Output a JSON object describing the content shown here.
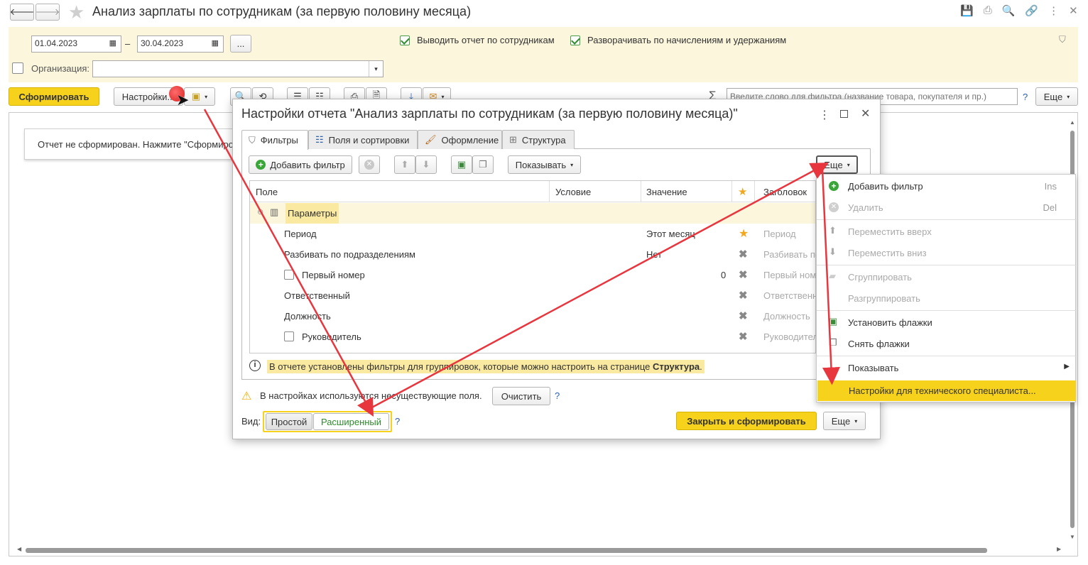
{
  "window": {
    "title": "Анализ зарплаты по сотрудникам (за первую половину месяца)"
  },
  "params": {
    "date_from": "01.04.2023",
    "date_to": "30.04.2023",
    "dash": "–",
    "ellipsis": "...",
    "show_by_employees_label": "Выводить отчет по сотрудникам",
    "expand_label": "Разворачивать по начислениям и удержаниям",
    "org_label": "Организация:",
    "org_value": ""
  },
  "toolbar": {
    "form_label": "Сформировать",
    "settings_label": "Настройки...",
    "sigma": "Σ",
    "search_placeholder": "Введите слово для фильтра (название товара, покупателя и пр.)",
    "help": "?",
    "more_label": "Еще"
  },
  "report": {
    "status": "Отчет не сформирован. Нажмите \"Сформировать\""
  },
  "dialog": {
    "title": "Настройки отчета \"Анализ зарплаты по сотрудникам (за первую половину месяца)\"",
    "tabs": [
      {
        "label": "Фильтры"
      },
      {
        "label": "Поля и сортировки"
      },
      {
        "label": "Оформление"
      },
      {
        "label": "Структура"
      }
    ],
    "add_filter_label": "Добавить фильтр",
    "show_label": "Показывать",
    "more_label": "Еще",
    "columns": {
      "field": "Поле",
      "condition": "Условие",
      "value": "Значение",
      "title": "Заголовок"
    },
    "group_label": "Параметры",
    "rows": [
      {
        "field": "Период",
        "value": "Этот месяц",
        "title": "Период"
      },
      {
        "field": "Разбивать по подразделениям",
        "value": "Нет",
        "title": "Разбивать по"
      },
      {
        "field": "Первый номер",
        "value": "0",
        "title": "Первый ном"
      },
      {
        "field": "Ответственный",
        "value": "",
        "title": "Ответственн"
      },
      {
        "field": "Должность",
        "value": "",
        "title": "Должность"
      },
      {
        "field": "Руководитель",
        "value": "",
        "title": "Руководител"
      }
    ],
    "info_text": "В отчете установлены фильтры для группировок, которые можно настроить на странице ",
    "info_bold": "Структура",
    "info_end": ".",
    "warning_text": "В настройках используются несуществующие поля.",
    "clear_label": "Очистить",
    "help": "?",
    "view_label": "Вид:",
    "view_simple": "Простой",
    "view_extended": "Расширенный",
    "close_form_label": "Закрыть и сформировать",
    "bottom_more_label": "Еще"
  },
  "menu": {
    "items": [
      {
        "label": "Добавить фильтр",
        "key": "Ins"
      },
      {
        "label": "Удалить",
        "key": "Del"
      },
      {
        "label": "Переместить вверх",
        "key": ""
      },
      {
        "label": "Переместить вниз",
        "key": ""
      },
      {
        "label": "Сгруппировать",
        "key": ""
      },
      {
        "label": "Разгруппировать",
        "key": ""
      },
      {
        "label": "Установить флажки",
        "key": ""
      },
      {
        "label": "Снять флажки",
        "key": ""
      },
      {
        "label": "Показывать",
        "key": ""
      },
      {
        "label": "Настройки для технического специалиста...",
        "key": ""
      }
    ]
  },
  "colors": {
    "accent_yellow": "#f7d21c",
    "param_bar": "#fcf6dc",
    "highlight": "#f9e9a1",
    "arrow": "#e8363f"
  }
}
